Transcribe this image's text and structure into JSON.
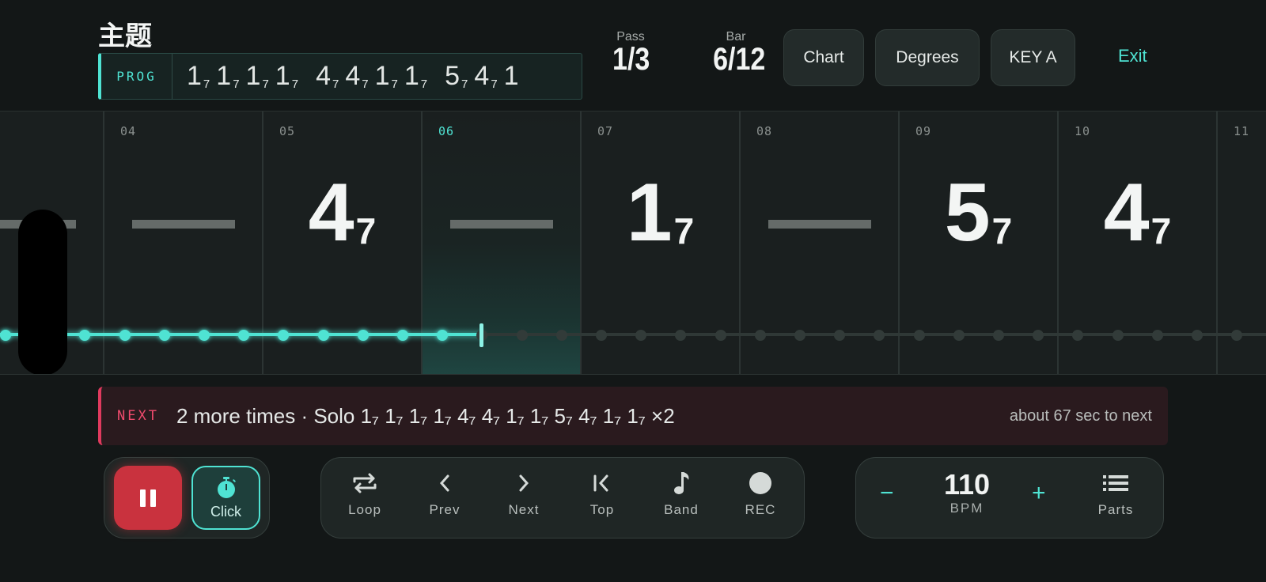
{
  "header": {
    "title": "主题",
    "prog_label": "PROG",
    "prog_chords": [
      {
        "root": "1",
        "q": "7"
      },
      {
        "root": "1",
        "q": "7"
      },
      {
        "root": "1",
        "q": "7"
      },
      {
        "root": "1",
        "q": "7"
      },
      {
        "root": "4",
        "q": "7"
      },
      {
        "root": "4",
        "q": "7"
      },
      {
        "root": "1",
        "q": "7"
      },
      {
        "root": "1",
        "q": "7"
      },
      {
        "root": "5",
        "q": "7"
      },
      {
        "root": "4",
        "q": "7"
      },
      {
        "root": "1",
        "q": ""
      }
    ],
    "pass_label": "Pass",
    "pass_value": "1/3",
    "bar_label": "Bar",
    "bar_value": "6/12",
    "chart_button": "Chart",
    "degrees_button": "Degrees",
    "key_button": "KEY A",
    "exit_link": "Exit"
  },
  "timeline": {
    "bars": [
      {
        "num": "04",
        "type": "dash"
      },
      {
        "num": "05",
        "type": "chord",
        "root": "4",
        "q": "7"
      },
      {
        "num": "06",
        "type": "dash",
        "current": true
      },
      {
        "num": "07",
        "type": "chord",
        "root": "1",
        "q": "7"
      },
      {
        "num": "08",
        "type": "dash"
      },
      {
        "num": "09",
        "type": "chord",
        "root": "5",
        "q": "7"
      },
      {
        "num": "10",
        "type": "chord",
        "root": "4",
        "q": "7"
      },
      {
        "num": "11",
        "type": "dash"
      }
    ],
    "played_beats": 12,
    "total_beats": 32
  },
  "next": {
    "tag": "NEXT",
    "text": "2 more times · Solo 1₇ 1₇ 1₇ 1₇ 4₇ 4₇ 1₇ 1₇ 5₇ 4₇ 1₇ 1₇ ×2",
    "eta": "about 67 sec to next"
  },
  "transport": {
    "click_label": "Click",
    "loop_label": "Loop",
    "prev_label": "Prev",
    "next_label": "Next",
    "top_label": "Top",
    "band_label": "Band",
    "rec_label": "REC",
    "minus": "−",
    "plus": "+",
    "bpm_value": "110",
    "bpm_unit": "BPM",
    "parts_label": "Parts"
  },
  "colors": {
    "accent": "#4fe3d3",
    "record": "#c9323e",
    "next_accent": "#e03a5e",
    "background": "#131717"
  },
  "icons": [
    "repeat-icon",
    "chevron-left-icon",
    "chevron-right-icon",
    "skip-to-start-icon",
    "music-note-icon",
    "record-dot-icon",
    "stopwatch-icon",
    "pause-icon",
    "list-icon"
  ]
}
